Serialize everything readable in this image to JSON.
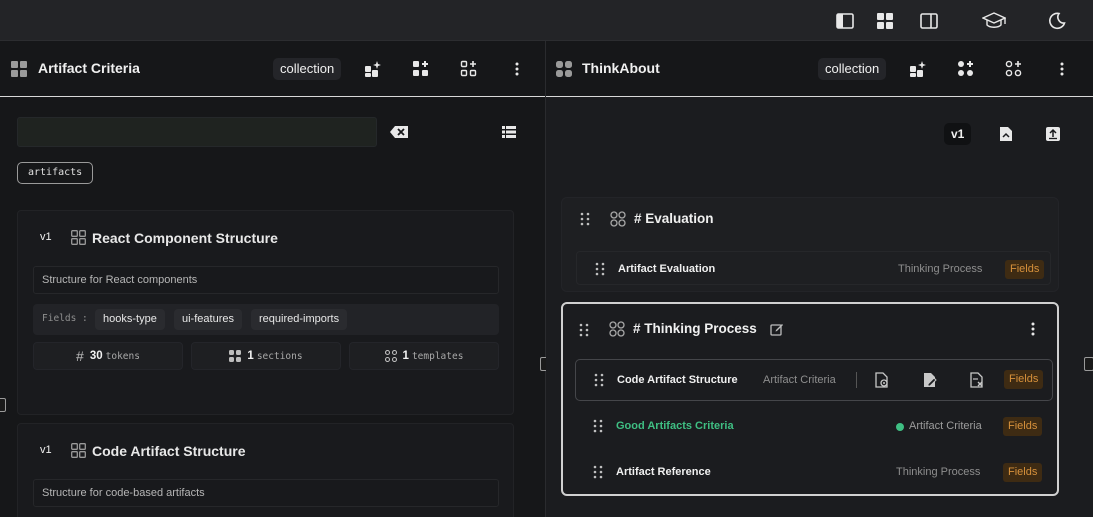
{
  "topbar": {
    "icons": [
      "sidebar-left-icon",
      "grid-icon",
      "sidebar-right-icon",
      "graduation-cap-icon",
      "moon-icon"
    ]
  },
  "left": {
    "title": "Artifact Criteria",
    "badge": "collection",
    "search": {
      "value": "",
      "placeholder": ""
    },
    "tag": "artifacts",
    "cards": [
      {
        "version": "v1",
        "title": "React Component Structure",
        "description": "Structure for React components",
        "fields_label": "Fields :",
        "fields": [
          "hooks-type",
          "ui-features",
          "required-imports"
        ],
        "stats": [
          {
            "value": "30",
            "unit": "tokens"
          },
          {
            "value": "1",
            "unit": "sections"
          },
          {
            "value": "1",
            "unit": "templates"
          }
        ]
      },
      {
        "version": "v1",
        "title": "Code Artifact Structure",
        "description": "Structure for code-based artifacts"
      }
    ]
  },
  "right": {
    "title": "ThinkAbout",
    "badge": "collection",
    "version": "v1",
    "sections": [
      {
        "title": "# Evaluation",
        "rows": [
          {
            "title": "Artifact Evaluation",
            "source": "Thinking Process",
            "badge": "Fields"
          }
        ]
      },
      {
        "title": "# Thinking Process",
        "rows": [
          {
            "title": "Code Artifact Structure",
            "source": "Artifact Criteria",
            "badge": "Fields"
          },
          {
            "title": "Good Artifacts Criteria",
            "source": "Artifact Criteria",
            "badge": "Fields",
            "status": "active"
          },
          {
            "title": "Artifact Reference",
            "source": "Thinking Process",
            "badge": "Fields"
          }
        ]
      }
    ]
  },
  "colors": {
    "accent_green": "#3fbf83",
    "fields_text": "#d7913b",
    "fields_bg": "#3e2b13",
    "bg": "#161719"
  }
}
